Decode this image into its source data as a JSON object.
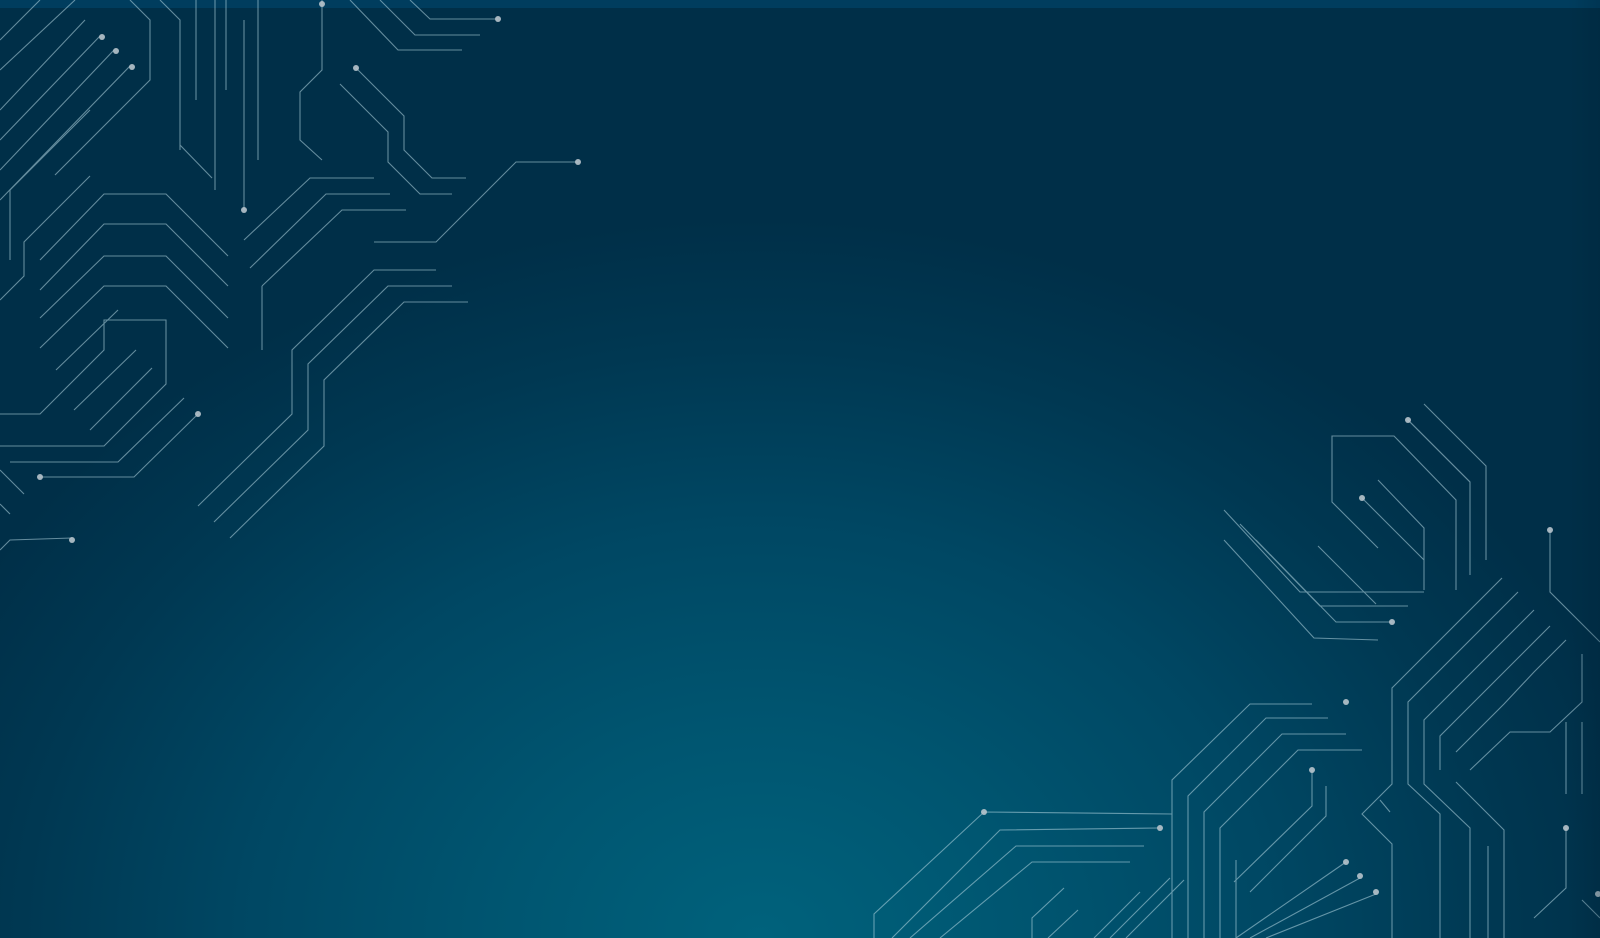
{
  "screen": {
    "background_colors": [
      "#002f48",
      "#003852",
      "#004763",
      "#005570",
      "#00627c"
    ],
    "circuit_stroke_color": "#b7d8e3",
    "node_color": "#b7c4cc",
    "top_strip_color": "#003d5e"
  }
}
